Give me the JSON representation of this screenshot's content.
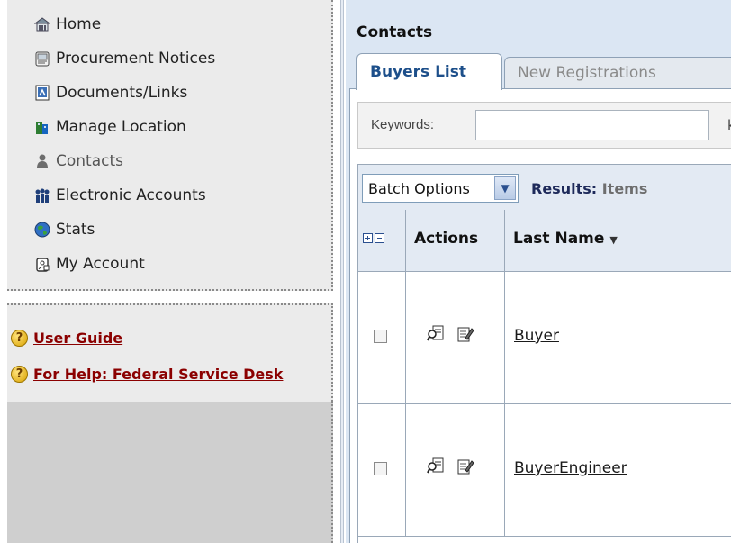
{
  "sidebar": {
    "nav": [
      {
        "label": "Home",
        "icon": "home-icon"
      },
      {
        "label": "Procurement Notices",
        "icon": "notices-icon"
      },
      {
        "label": "Documents/Links",
        "icon": "documents-icon"
      },
      {
        "label": "Manage Location",
        "icon": "location-icon"
      },
      {
        "label": "Contacts",
        "icon": "contacts-icon",
        "active": true
      },
      {
        "label": "Electronic Accounts",
        "icon": "accounts-icon"
      },
      {
        "label": "Stats",
        "icon": "globe-icon"
      },
      {
        "label": "My Account",
        "icon": "account-icon"
      }
    ],
    "help": [
      {
        "label": "User Guide",
        "icon": "help-icon"
      },
      {
        "label": "For Help: Federal Service Desk",
        "icon": "help-icon"
      }
    ],
    "help_glyph": "?"
  },
  "main": {
    "title": "Contacts",
    "tabs": [
      {
        "label": "Buyers List",
        "active": true
      },
      {
        "label": "New Registrations",
        "active": false
      }
    ],
    "search": {
      "keywords_label": "Keywords:",
      "keywords_value": "",
      "next_label_cut": "k"
    },
    "grid": {
      "batch_options": "Batch Options",
      "results_label": "Results:",
      "results_items": "Items",
      "columns": {
        "actions": "Actions",
        "last_name": "Last Name",
        "sort_indicator": "▼"
      },
      "rows": [
        {
          "last_name": "Buyer"
        },
        {
          "last_name": "BuyerEngineer"
        }
      ]
    }
  },
  "colors": {
    "nav_bg": "#ebebeb",
    "main_bg": "#dbe6f3",
    "help_link": "#8b0000",
    "active_tab_text": "#1d4f8a",
    "results_label": "#1e2a5a"
  }
}
